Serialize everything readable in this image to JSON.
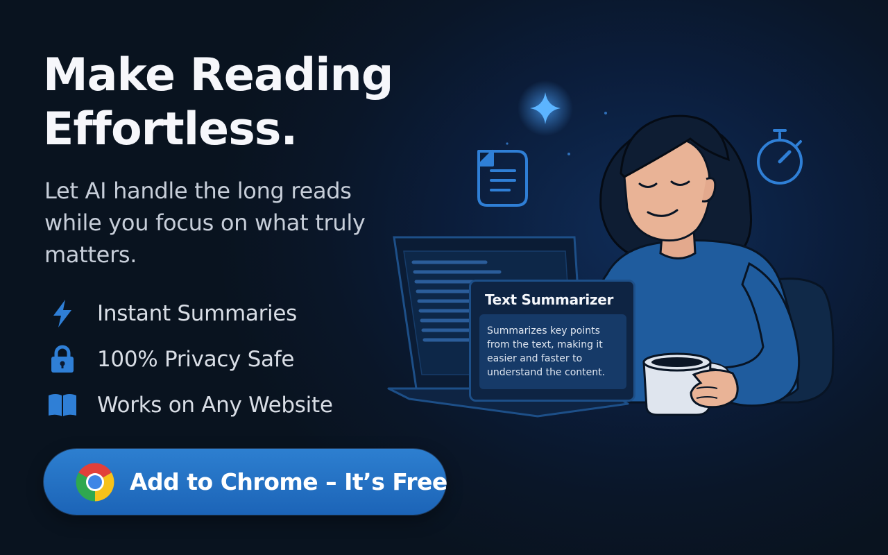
{
  "hero": {
    "headline_line1": "Make Reading",
    "headline_line2": "Effortless.",
    "subtitle": "Let AI handle the long reads while you focus on what truly matters."
  },
  "features": [
    {
      "icon": "lightning-bolt-icon",
      "label": "Instant Summaries"
    },
    {
      "icon": "lock-icon",
      "label": "100% Privacy Safe"
    },
    {
      "icon": "open-book-icon",
      "label": "Works on Any Website"
    }
  ],
  "cta": {
    "icon": "chrome-logo-icon",
    "label": "Add to Chrome – It’s Free"
  },
  "summarizer_card": {
    "title": "Text Summarizer",
    "description": "Summarizes key points from the text, making it easier and faster to understand the content."
  },
  "colors": {
    "background": "#0a1628",
    "accent": "#2d7fd0",
    "icon_blue": "#2f7fd6",
    "text_primary": "#f6f7fb",
    "text_secondary": "#c7ced9"
  }
}
